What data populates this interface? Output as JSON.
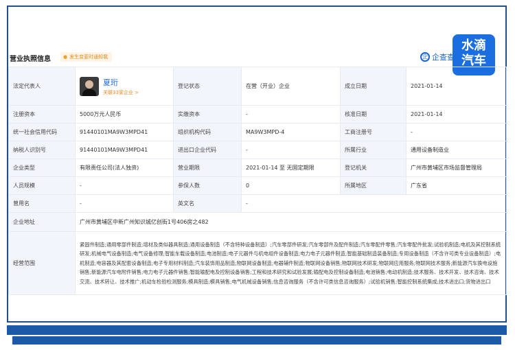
{
  "header": {
    "section_title": "营业执照信息",
    "hint": "发生变更时通知我",
    "brand": "企查查"
  },
  "watermark": {
    "line1": "水滴",
    "line2": "汽车"
  },
  "legal_rep": {
    "label": "法定代表人",
    "name": "夏珩",
    "related": "关联33家企业 >"
  },
  "rows": {
    "reg_status_label": "登记状态",
    "reg_status": "在营（开业）企业",
    "est_date_label": "成立日期",
    "est_date": "2021-01-14",
    "capital_label": "注册资本",
    "capital": "5000万元人民币",
    "paid_capital_label": "实缴资本",
    "paid_capital": "-",
    "approve_date_label": "核准日期",
    "approve_date": "2021-01-14",
    "credit_code_label": "统一社会信用代码",
    "credit_code": "91440101MA9W3MPD41",
    "org_code_label": "组织机构代码",
    "org_code": "MA9W3MPD-4",
    "biz_reg_label": "工商注册号",
    "biz_reg": "-",
    "taxpayer_label": "纳税人识别号",
    "taxpayer": "91440101MA9W3MPD41",
    "import_code_label": "进出口企业代码",
    "import_code": "-",
    "industry_label": "所属行业",
    "industry": "通用设备制造业",
    "type_label": "企业类型",
    "type": "有限责任公司(法人独资)",
    "term_label": "营业期限",
    "term": "2021-01-14 至 无固定期限",
    "authority_label": "登记机关",
    "authority": "广州市黄埔区市场监督管理局",
    "staff_label": "人员规模",
    "staff": "-",
    "insured_label": "参保人数",
    "insured": "0",
    "region_label": "所属地区",
    "region": "广东省",
    "former_label": "曾用名",
    "former": "-",
    "english_label": "英文名",
    "english": "-",
    "address_label": "企业地址",
    "address": "广州市黄埔区中新广州知识城亿创街1号406房之482",
    "scope_label": "经营范围",
    "scope": "紧固件制造;通用零部件制造;增材及类似器具制造;通用设备制造（不含特种设备制造）;汽车零部件研发;汽车零部件及配件制造;汽车零配件零售;汽车零配件批发;试验机制造;电机及其控制系统研发;机械电气设备制造;电气设备修理;智能车载设备制造;电池制造;电子元器件与机电组件设备制造;电力电子元器件制造;智能基础制造装备制造;专用设备制造（不含许可类专业设备制造）;电机制造;电容器及其配套设备制造;电子专用材料制造;汽车装饰用品制造;物联网设备制造;电器辅件制造;物联网设备销售;物联网技术研发;物联网应用服务;物联网技术服务;新能源汽车换电设施销售;新能源汽车电附件销售;电力电子元器件销售;智能输配电及控制设备销售;工程和技术研究和试验发展;输配电及控制设备制造;电池销售;电动机制造;技术服务、技术开发、技术咨询、技术交流、技术转让、技术推广;机动车检验检测服务;模具制造;模具销售;电气机械设备销售;信息咨询服务（不含许可类信息咨询服务）;试验机销售;智能控制系统集成;技术进出口;货物进出口"
  }
}
